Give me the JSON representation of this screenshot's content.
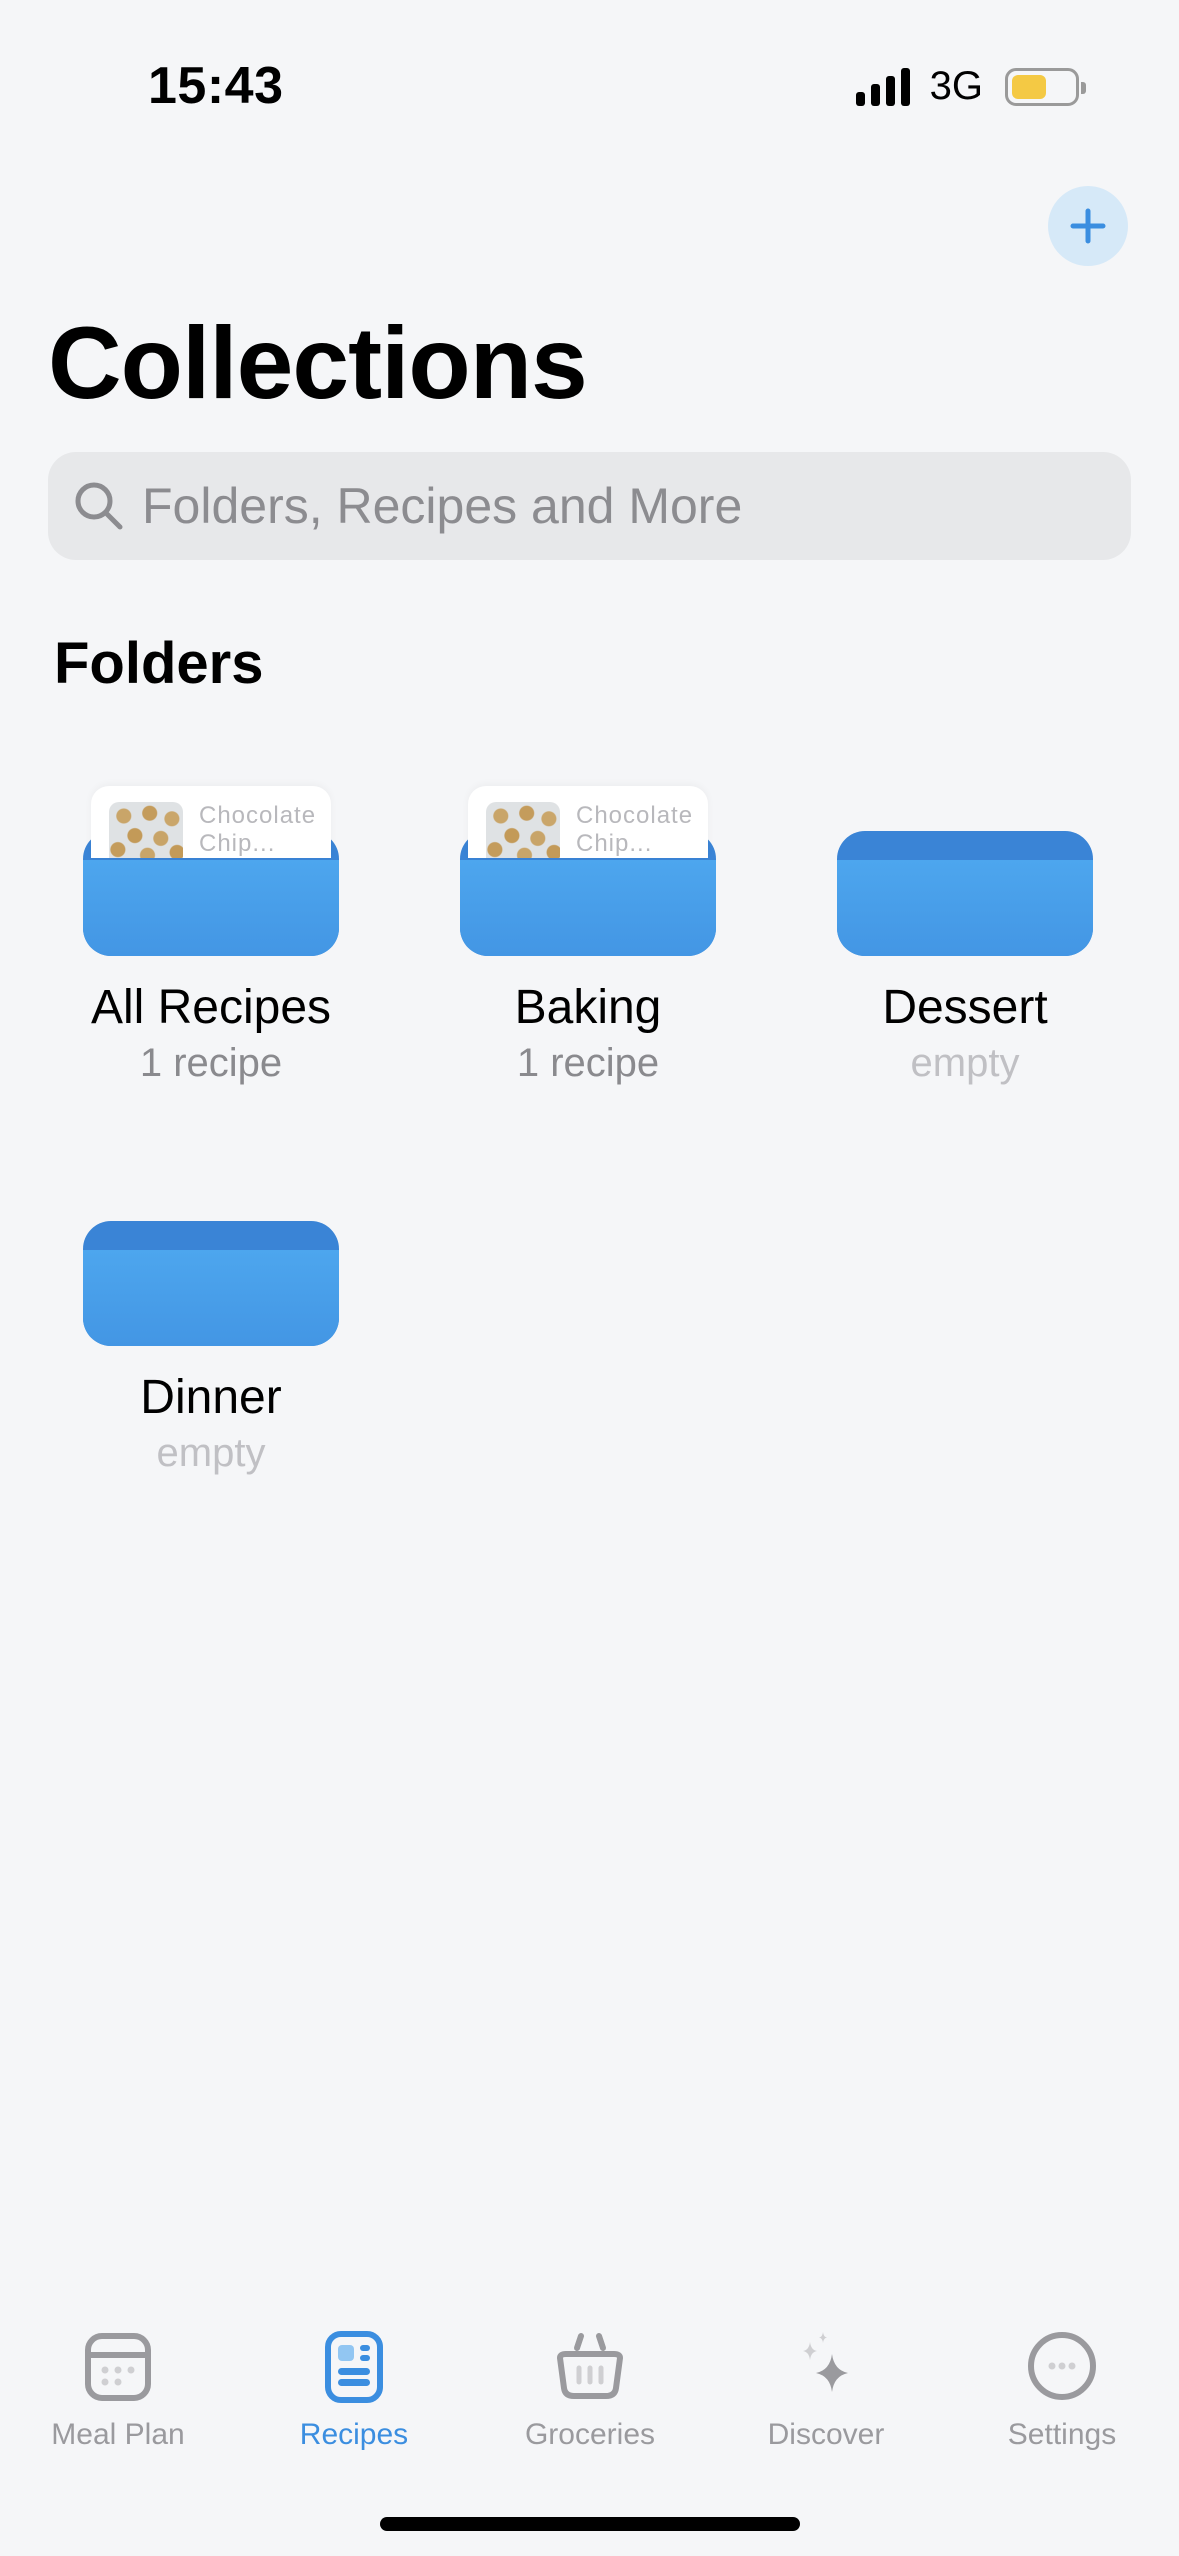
{
  "status_bar": {
    "time": "15:43",
    "network": "3G",
    "icons": [
      "signal-bars-icon",
      "battery-icon"
    ],
    "battery_color": "#f4c944",
    "battery_level": 0.45
  },
  "header": {
    "add_button_icon": "plus-icon",
    "title": "Collections"
  },
  "search": {
    "icon": "search-icon",
    "placeholder": "Folders, Recipes and More",
    "value": ""
  },
  "folders_section": {
    "title": "Folders",
    "folders": [
      {
        "name": "All Recipes",
        "subtitle": "1 recipe",
        "preview_card": "Chocolate Chip..."
      },
      {
        "name": "Baking",
        "subtitle": "1 recipe",
        "preview_card": "Chocolate Chip..."
      },
      {
        "name": "Dessert",
        "subtitle": "empty"
      },
      {
        "name": "Dinner",
        "subtitle": "empty"
      }
    ]
  },
  "tab_bar": {
    "active": "Recipes",
    "accent_color": "#3b8ee0",
    "tabs": [
      {
        "label": "Meal Plan",
        "icon": "calendar-icon"
      },
      {
        "label": "Recipes",
        "icon": "recipe-card-icon"
      },
      {
        "label": "Groceries",
        "icon": "basket-icon"
      },
      {
        "label": "Discover",
        "icon": "sparkles-icon"
      },
      {
        "label": "Settings",
        "icon": "more-circle-icon"
      }
    ]
  }
}
